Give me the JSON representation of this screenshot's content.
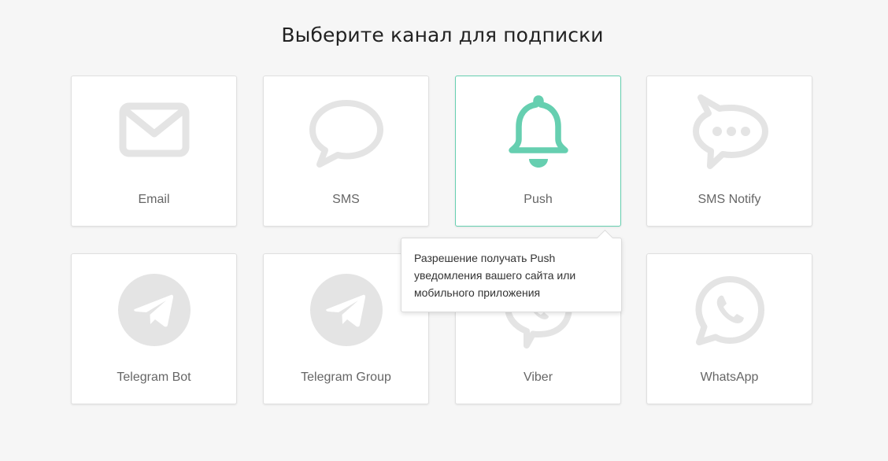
{
  "page": {
    "title": "Выберите канал для подписки"
  },
  "channels": [
    {
      "label": "Email",
      "icon": "envelope-icon",
      "selected": false
    },
    {
      "label": "SMS",
      "icon": "speech-bubble-icon",
      "selected": false
    },
    {
      "label": "Push",
      "icon": "bell-icon",
      "selected": true
    },
    {
      "label": "SMS Notify",
      "icon": "chat-dots-icon",
      "selected": false
    },
    {
      "label": "Telegram Bot",
      "icon": "telegram-icon",
      "selected": false
    },
    {
      "label": "Telegram Group",
      "icon": "telegram-icon",
      "selected": false
    },
    {
      "label": "Viber",
      "icon": "viber-icon",
      "selected": false
    },
    {
      "label": "WhatsApp",
      "icon": "whatsapp-icon",
      "selected": false
    }
  ],
  "tooltip": {
    "text": "Разрешение получать Push уведомления вашего сайта или мобильного приложения"
  },
  "colors": {
    "accent": "#66cfb0",
    "icon_inactive": "#e4e4e4",
    "background": "#f6f6f6"
  }
}
